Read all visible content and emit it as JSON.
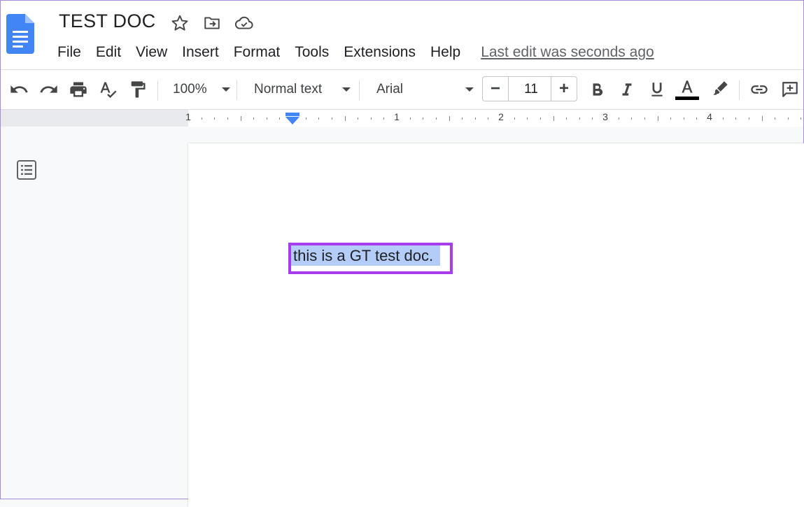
{
  "document": {
    "title": "TEST DOC",
    "last_edit": "Last edit was seconds ago",
    "body_text": "this is a GT test doc."
  },
  "menu": [
    "File",
    "Edit",
    "View",
    "Insert",
    "Format",
    "Tools",
    "Extensions",
    "Help"
  ],
  "toolbar": {
    "zoom": "100%",
    "style": "Normal text",
    "font": "Arial",
    "font_size": "11"
  },
  "ruler": {
    "labels": [
      "1",
      "1",
      "2",
      "3",
      "4"
    ]
  },
  "icons": [
    "docs-logo-icon",
    "star-icon",
    "move-folder-icon",
    "cloud-saved-icon",
    "undo-icon",
    "redo-icon",
    "print-icon",
    "spellcheck-icon",
    "paint-format-icon",
    "bold-icon",
    "italic-icon",
    "underline-icon",
    "text-color-icon",
    "highlight-icon",
    "link-icon",
    "add-comment-icon",
    "outline-icon"
  ],
  "colors": {
    "accent": "#4285f4",
    "selection": "#b3cdf8",
    "highlight_border": "#a83ded",
    "text_color_bar": "#000000"
  }
}
